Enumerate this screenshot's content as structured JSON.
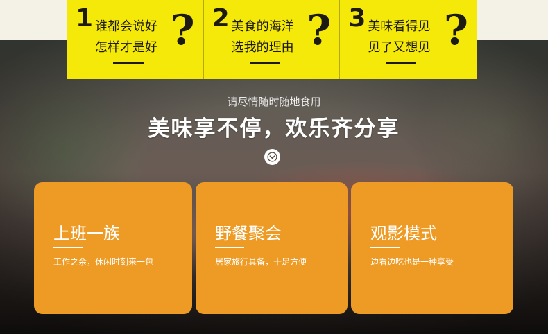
{
  "questions": [
    {
      "number": "1",
      "line1": "谁都会说好",
      "line2": "怎样才是好",
      "mark": "?"
    },
    {
      "number": "2",
      "line1": "美食的海洋",
      "line2": "选我的理由",
      "mark": "?"
    },
    {
      "number": "3",
      "line1": "美味看得见",
      "line2": "见了又想见",
      "mark": "?"
    }
  ],
  "hero": {
    "subtitle": "请尽情随时随地食用",
    "headline": "美味享不停，欢乐齐分享",
    "scroll_icon": "chevron-down-circle-icon"
  },
  "cards": [
    {
      "title": "上班一族",
      "desc": "工作之余，休闲时刻来一包"
    },
    {
      "title": "野餐聚会",
      "desc": "居家旅行具备，十足方便"
    },
    {
      "title": "观影模式",
      "desc": "边看边吃也是一种享受"
    }
  ],
  "colors": {
    "question_bg": "#f5e90a",
    "card_bg": "#ed9b24",
    "text_dark": "#1d1a12"
  }
}
